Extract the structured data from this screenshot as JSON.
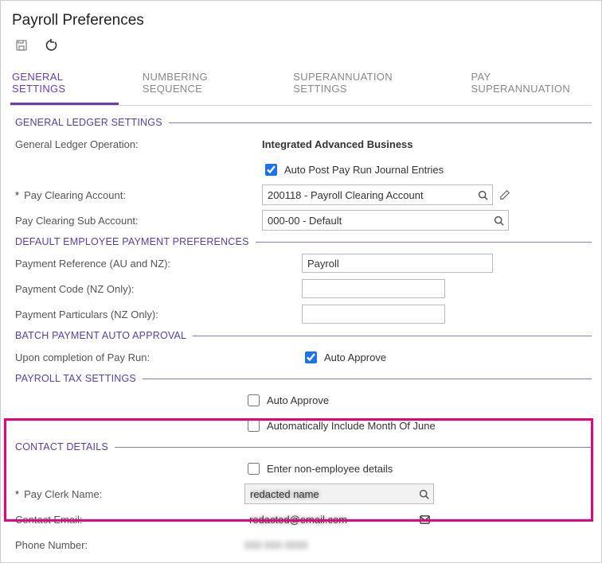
{
  "page_title": "Payroll Preferences",
  "toolbar": {
    "save_tooltip": "Save",
    "revert_tooltip": "Revert"
  },
  "tabs": [
    {
      "label": "GENERAL SETTINGS",
      "active": true
    },
    {
      "label": "NUMBERING SEQUENCE",
      "active": false
    },
    {
      "label": "SUPERANNUATION SETTINGS",
      "active": false
    },
    {
      "label": "PAY SUPERANNUATION",
      "active": false
    }
  ],
  "sections": {
    "gl": {
      "title": "GENERAL LEDGER SETTINGS",
      "fields": {
        "gl_operation_label": "General Ledger Operation:",
        "gl_operation_value": "Integrated Advanced Business",
        "auto_post_label": "Auto Post Pay Run Journal Entries",
        "auto_post_checked": true,
        "pay_clearing_label": "Pay Clearing Account:",
        "pay_clearing_required": true,
        "pay_clearing_value": "200118 - Payroll Clearing Account",
        "pay_clearing_sub_label": "Pay Clearing Sub Account:",
        "pay_clearing_sub_value": "000-00 - Default"
      }
    },
    "defpay": {
      "title": "DEFAULT EMPLOYEE PAYMENT PREFERENCES",
      "fields": {
        "ref_label": "Payment Reference (AU and NZ):",
        "ref_value": "Payroll",
        "code_label": "Payment Code (NZ Only):",
        "code_value": "",
        "part_label": "Payment Particulars (NZ Only):",
        "part_value": ""
      }
    },
    "batch": {
      "title": "BATCH PAYMENT AUTO APPROVAL",
      "fields": {
        "upon_label": "Upon completion of Pay Run:",
        "auto_approve_label": "Auto Approve",
        "auto_approve_checked": true
      }
    },
    "tax": {
      "title": "PAYROLL TAX SETTINGS",
      "fields": {
        "auto_approve_label": "Auto Approve",
        "auto_approve_checked": false,
        "include_june_label": "Automatically Include Month Of June",
        "include_june_checked": false
      }
    },
    "contact": {
      "title": "CONTACT DETAILS",
      "fields": {
        "enter_nonemp_label": "Enter non-employee details",
        "enter_nonemp_checked": false,
        "clerk_label": "Pay Clerk Name:",
        "clerk_required": true,
        "clerk_value": "",
        "email_label": "Contact Email:",
        "email_value": "",
        "phone_label": "Phone Number:",
        "phone_value": ""
      }
    }
  }
}
